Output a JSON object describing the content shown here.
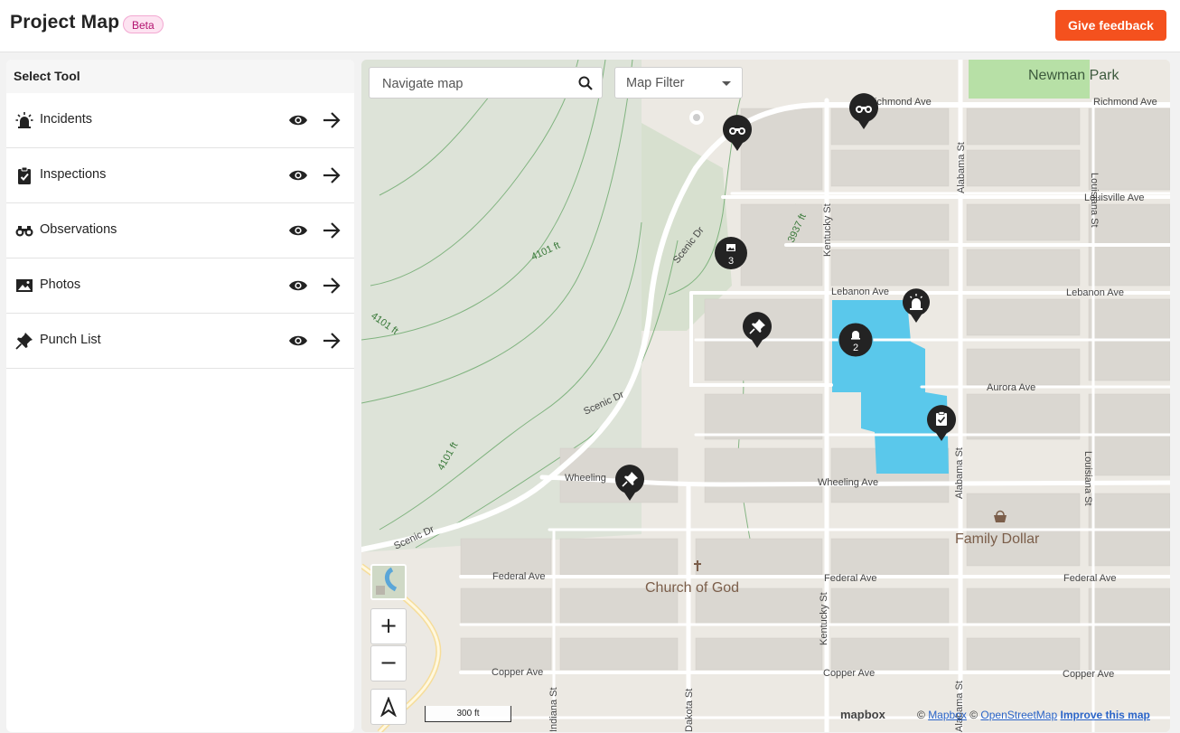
{
  "header": {
    "title": "Project Map",
    "badge": "Beta",
    "feedback_label": "Give feedback"
  },
  "panel": {
    "title": "Select Tool",
    "tools": [
      {
        "label": "Incidents",
        "icon": "siren-icon"
      },
      {
        "label": "Inspections",
        "icon": "clipboard-check-icon"
      },
      {
        "label": "Observations",
        "icon": "binoculars-icon"
      },
      {
        "label": "Photos",
        "icon": "image-icon"
      },
      {
        "label": "Punch List",
        "icon": "pushpin-icon"
      }
    ]
  },
  "map": {
    "search_placeholder": "Navigate map",
    "filter_label": "Map Filter",
    "zoom_in": "+",
    "zoom_out": "−",
    "scale_label": "300 ft",
    "attribution": {
      "copyright": "©",
      "mapbox": "Mapbox",
      "osm": "OpenStreetMap",
      "improve": "Improve this map",
      "logo": "mapbox"
    },
    "labels": {
      "newman_park": "Newman Park",
      "richmond_ave_1": "Richmond Ave",
      "richmond_ave_2": "Richmond Ave",
      "louisville_ave": "Louisville Ave",
      "lebanon_ave_1": "Lebanon Ave",
      "lebanon_ave_2": "Lebanon Ave",
      "aurora_ave": "Aurora Ave",
      "wheeling_ave": "Wheeling Ave",
      "wheeling": "Wheeling",
      "federal_ave_1": "Federal Ave",
      "federal_ave_2": "Federal Ave",
      "federal_ave_3": "Federal Ave",
      "copper_ave_1": "Copper Ave",
      "copper_ave_2": "Copper Ave",
      "copper_ave_3": "Copper Ave",
      "family_dollar": "Family Dollar",
      "church_of_god": "Church of God",
      "scenic_dr_1": "Scenic Dr",
      "scenic_dr_2": "Scenic Dr",
      "scenic_dr_3": "Scenic Dr",
      "kentucky_st_1": "Kentucky St",
      "kentucky_st_2": "Kentucky St",
      "alabama_st_1": "Alabama St",
      "alabama_st_2": "Alabama St",
      "alabama_st_3": "Alabama St",
      "louisiana_st_1": "Louisiana St",
      "louisiana_st_2": "Louisiana St",
      "dakota_st": "Dakota St",
      "indiana_st": "Indiana St",
      "contour_4101_1": "4101 ft",
      "contour_4101_2": "4101 ft",
      "contour_4101_3": "4101 ft",
      "contour_3937": "3937 ft"
    },
    "markers": {
      "photos_cluster": "3",
      "incidents_cluster": "2"
    },
    "colors": {
      "accent": "#f4511e",
      "project_area": "#5ac8eb",
      "park": "#b7e0a6"
    }
  }
}
